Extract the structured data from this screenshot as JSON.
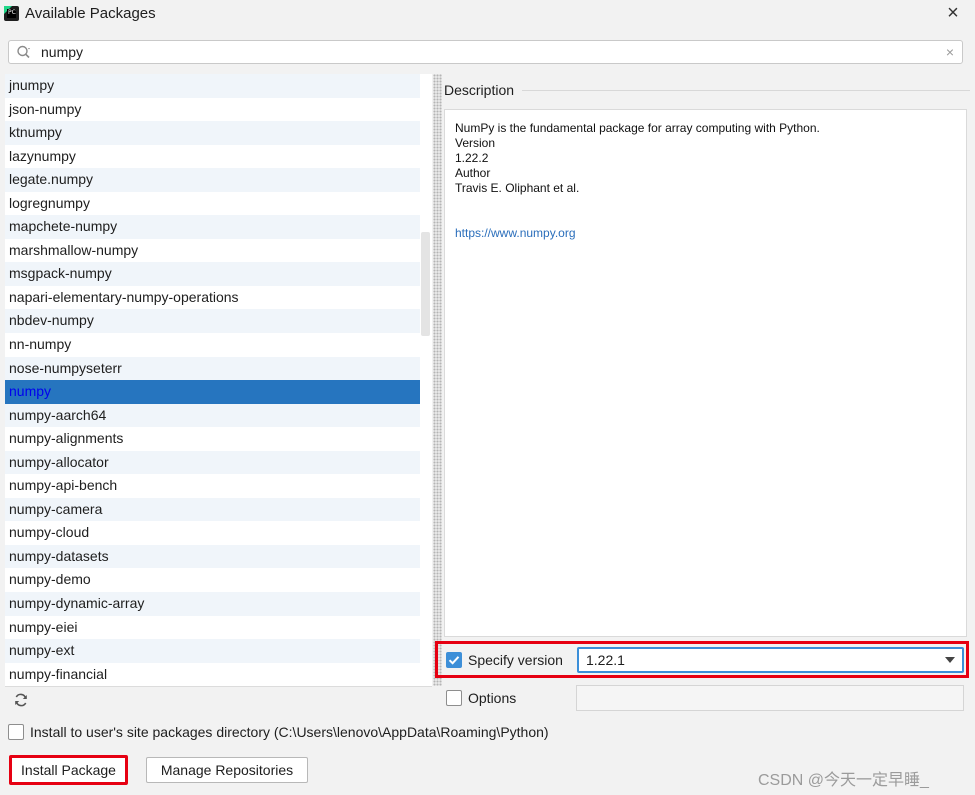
{
  "window": {
    "title": "Available Packages",
    "close": "×",
    "app_icon_text": "PC"
  },
  "search": {
    "value": "numpy",
    "placeholder": "",
    "clear": "×"
  },
  "packages": [
    "jnumpy",
    "json-numpy",
    "ktnumpy",
    "lazynumpy",
    "legate.numpy",
    "logregnumpy",
    "mapchete-numpy",
    "marshmallow-numpy",
    "msgpack-numpy",
    "napari-elementary-numpy-operations",
    "nbdev-numpy",
    "nn-numpy",
    "nose-numpyseterr",
    "numpy",
    "numpy-aarch64",
    "numpy-alignments",
    "numpy-allocator",
    "numpy-api-bench",
    "numpy-camera",
    "numpy-cloud",
    "numpy-datasets",
    "numpy-demo",
    "numpy-dynamic-array",
    "numpy-eiei",
    "numpy-ext",
    "numpy-financial"
  ],
  "selected_package": "numpy",
  "description": {
    "header": "Description",
    "summary": "NumPy is the fundamental package for array computing with Python.",
    "version_label": "Version",
    "version": "1.22.2",
    "author_label": "Author",
    "author": "Travis E. Oliphant et al.",
    "url": "https://www.numpy.org"
  },
  "specify_version": {
    "checked": true,
    "label": "Specify version",
    "value": "1.22.1"
  },
  "options": {
    "checked": false,
    "label": "Options",
    "value": ""
  },
  "install_user": {
    "checked": false,
    "label": "Install to user's site packages directory (C:\\Users\\lenovo\\AppData\\Roaming\\Python)"
  },
  "buttons": {
    "install": "Install Package",
    "manage": "Manage Repositories"
  },
  "watermark": "CSDN @今天一定早睡_",
  "colors": {
    "selection": "#2675bf",
    "highlight_box": "#e60012",
    "link": "#2a6ebb",
    "checkbox_on": "#3d8fd8"
  }
}
